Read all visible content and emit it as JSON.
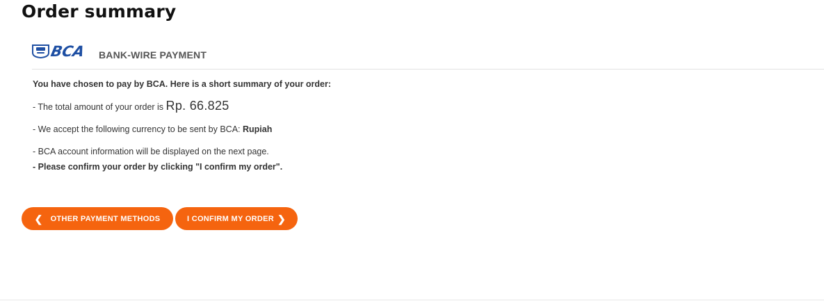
{
  "page": {
    "title": "Order summary"
  },
  "payment": {
    "logo_text": "BCA",
    "subtitle": "BANK-WIRE PAYMENT",
    "intro": "You have chosen to pay by BCA. Here is a short summary of your order:",
    "total_prefix": "- The total amount of your order is ",
    "total_amount": "Rp. 66.825",
    "currency_prefix": "- We accept the following currency to be sent by BCA: ",
    "currency": "Rupiah",
    "account_info": "- BCA account information will be displayed on the next page.",
    "confirm_prefix": "- ",
    "confirm_note": "Please confirm your order by clicking \"I confirm my order\"."
  },
  "buttons": {
    "other_methods": "OTHER PAYMENT METHODS",
    "confirm": "I CONFIRM MY ORDER"
  },
  "colors": {
    "accent": "#f5640f",
    "bca_blue": "#1e4fa3"
  },
  "icons": {
    "back": "chevron-left-icon",
    "forward": "chevron-right-icon"
  }
}
